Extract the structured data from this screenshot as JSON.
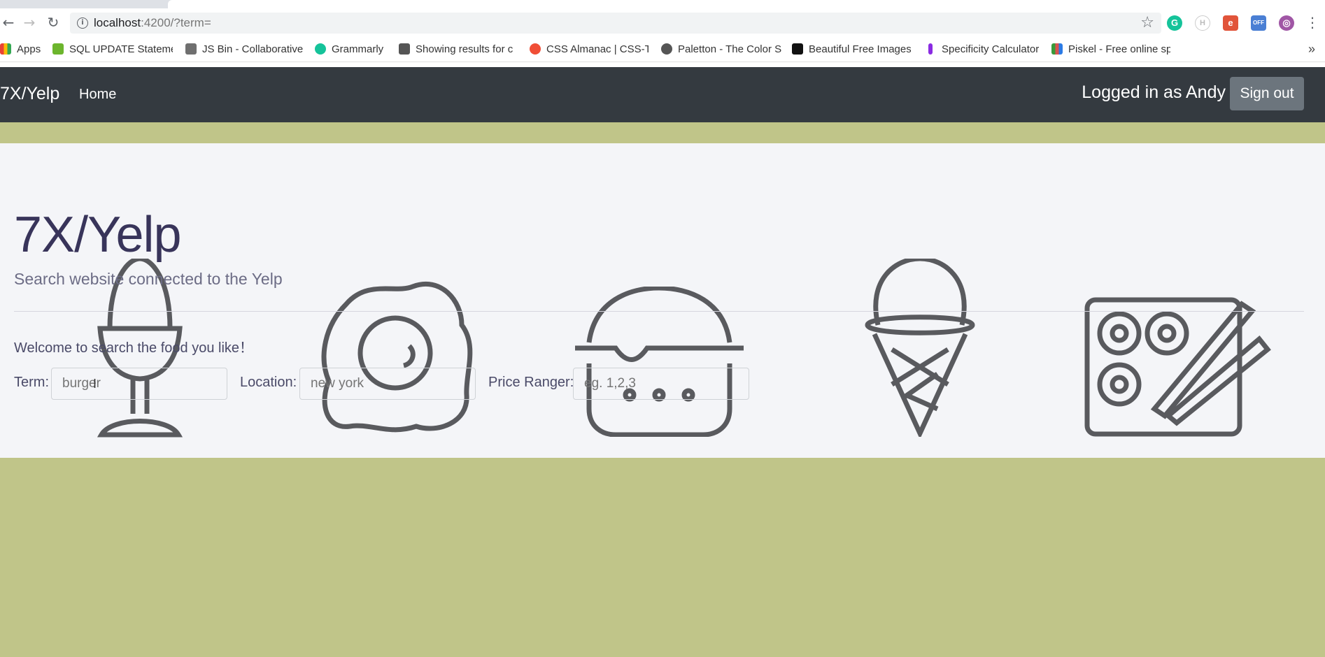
{
  "browser": {
    "url_host": "localhost",
    "url_rest": ":4200/?term=",
    "extensions": [
      {
        "icon": "grammarly-icon",
        "color": "#15c39a",
        "glyph": "G"
      },
      {
        "icon": "honey-icon",
        "color": "#bbbbbb",
        "glyph": "H"
      },
      {
        "icon": "evernote-icon",
        "color": "#e1543a",
        "glyph": "e"
      },
      {
        "icon": "off-extension-icon",
        "color": "#4a7fd4",
        "glyph": "OFF"
      },
      {
        "icon": "purple-extension-icon",
        "color": "#a056a5",
        "glyph": "◎"
      }
    ],
    "bookmarks": [
      {
        "label": "Apps",
        "icon": "apps-grid-icon",
        "color": "#4285f4"
      },
      {
        "label": "SQL UPDATE Stateme",
        "icon": "sql-icon",
        "color": "#6cb52d"
      },
      {
        "label": "JS Bin - Collaborative",
        "icon": "jsbin-icon",
        "color": "#444"
      },
      {
        "label": "Grammarly",
        "icon": "grammarly-icon",
        "color": "#15c39a"
      },
      {
        "label": "Showing results for c",
        "icon": "duck-icon",
        "color": "#555"
      },
      {
        "label": "CSS Almanac | CSS-Tr",
        "icon": "css-tricks-icon",
        "color": "#f04e36"
      },
      {
        "label": "Paletton - The Color S",
        "icon": "paletton-icon",
        "color": "#555"
      },
      {
        "label": "Beautiful Free Images",
        "icon": "unsplash-icon",
        "color": "#111"
      },
      {
        "label": "Specificity Calculator",
        "icon": "specificity-icon",
        "color": "#8a2be2"
      },
      {
        "label": "Piskel - Free online sp",
        "icon": "piskel-icon",
        "color": "#3a9a3a"
      }
    ]
  },
  "navbar": {
    "brand": "7X/Yelp",
    "home": "Home",
    "logged_in": "Logged in as Andy",
    "sign_out": "Sign out"
  },
  "jumbotron": {
    "title": "7X/Yelp",
    "subtitle": "Search website connected to the Yelp",
    "welcome": "Welcome to search the food you like！",
    "background_icons": [
      "egg-cup-icon",
      "fried-egg-icon",
      "burger-icon",
      "ice-cream-icon",
      "sushi-icon"
    ]
  },
  "form": {
    "term_label": "Term:",
    "term_placeholder": "burger",
    "location_label": "Location:",
    "location_placeholder": "new york",
    "price_label": "Price Ranger:",
    "price_placeholder": "eg. 1,2,3"
  },
  "colors": {
    "page_bg": "#c0c589",
    "navbar_bg": "#343a40",
    "jumbotron_bg": "#f4f5f8",
    "signout_bg": "#6c757d"
  }
}
